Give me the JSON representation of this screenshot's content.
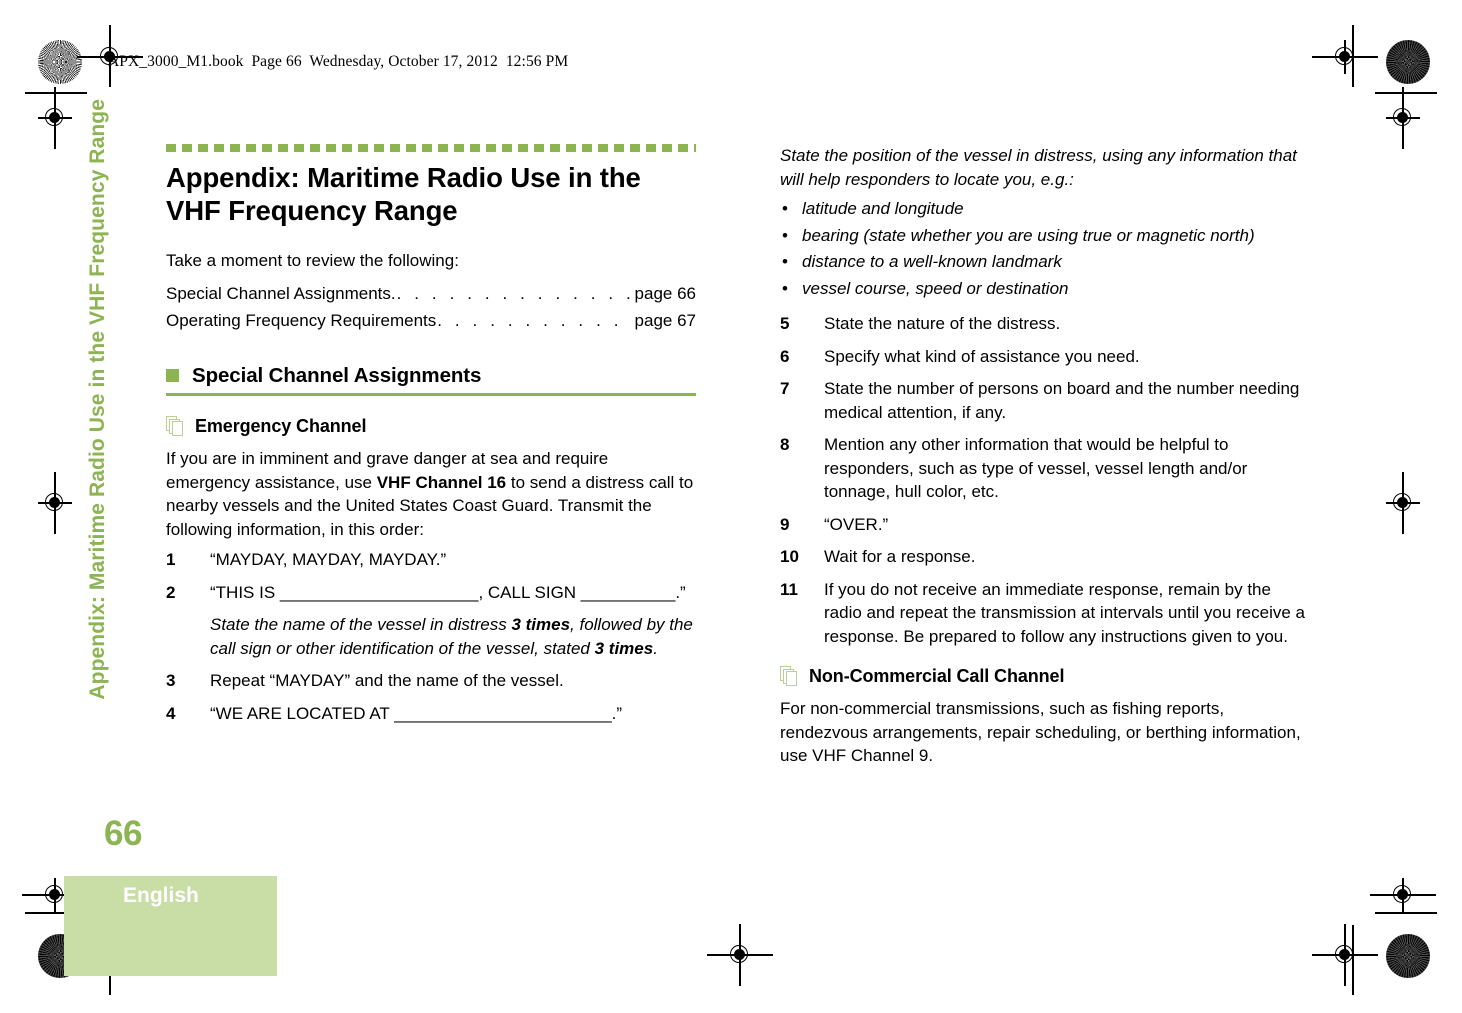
{
  "header": {
    "file_info": "APX_3000_M1.book  Page 66  Wednesday, October 17, 2012  12:56 PM"
  },
  "side_tab": {
    "label": "Appendix: Maritime Radio Use in the VHF Frequency Range"
  },
  "chapter": {
    "title": "Appendix: Maritime Radio Use in the VHF Frequency Range",
    "intro": "Take a moment to review the following:",
    "toc": [
      {
        "label": "Special Channel Assignments.",
        "leader": ". . . . . . . . . . . . . . . . .",
        "page": "page 66"
      },
      {
        "label": "Operating Frequency Requirements",
        "leader": ". . . . . . . . . . . . .",
        "page": "page 67"
      }
    ]
  },
  "section": {
    "title": "Special Channel Assignments"
  },
  "emergency": {
    "title": "Emergency Channel",
    "intro_part1": "If you are in imminent and grave danger at sea and require emergency assistance, use ",
    "intro_bold": "VHF Channel 16",
    "intro_part2": " to send a distress call to nearby vessels and the United States Coast Guard. Transmit the following information, in this order:",
    "steps": [
      {
        "num": "1",
        "text": "“MAYDAY, MAYDAY, MAYDAY.”"
      },
      {
        "num": "2",
        "text": "“THIS IS _____________________, CALL SIGN __________.”",
        "note_part1": "State the name of the vessel in distress ",
        "note_bold1": "3 times",
        "note_part2": ", followed by the call sign or other identification of the vessel, stated ",
        "note_bold2": "3 times",
        "note_part3": "."
      },
      {
        "num": "3",
        "text": "Repeat “MAYDAY” and the name of the vessel."
      },
      {
        "num": "4",
        "text": "“WE ARE LOCATED AT _______________________.”"
      }
    ]
  },
  "position_note": {
    "text": "State the position of the vessel in distress, using any information that will help responders to locate you, e.g.:",
    "bullets": [
      "latitude and longitude",
      "bearing (state whether you are using true or magnetic north)",
      "distance to a well-known landmark",
      "vessel course, speed or destination"
    ]
  },
  "steps_continued": [
    {
      "num": "5",
      "text": "State the nature of the distress."
    },
    {
      "num": "6",
      "text": "Specify what kind of assistance you need."
    },
    {
      "num": "7",
      "text": "State the number of persons on board and the number needing medical attention, if any."
    },
    {
      "num": "8",
      "text": "Mention any other information that would be helpful to responders, such as type of vessel, vessel length and/or tonnage, hull color, etc."
    },
    {
      "num": "9",
      "text": "“OVER.”"
    },
    {
      "num": "10",
      "text": "Wait for a response."
    },
    {
      "num": "11",
      "text": "If you do not receive an immediate response, remain by the radio and repeat the transmission at intervals until you receive a response. Be prepared to follow any instructions given to you."
    }
  ],
  "non_commercial": {
    "title": "Non-Commercial Call Channel",
    "body": "For non-commercial transmissions, such as fishing reports, rendezvous arrangements, repair scheduling, or berthing information, use VHF Channel 9."
  },
  "footer": {
    "page_number": "66",
    "language": "English"
  },
  "colors": {
    "accent_green": "#8CB453",
    "tab_green": "#C8DEA6",
    "icon_green": "#B9D293"
  }
}
